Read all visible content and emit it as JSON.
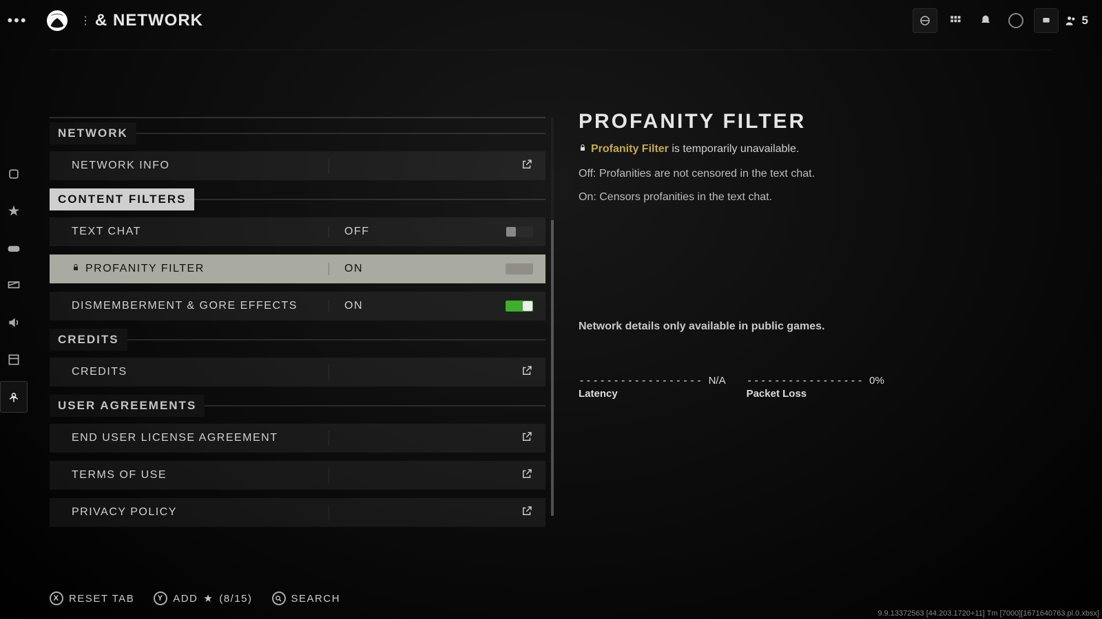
{
  "header": {
    "page_title": "& NETWORK",
    "party_count": "5"
  },
  "sections": {
    "network": {
      "label": "NETWORK"
    },
    "content_filters": {
      "label": "CONTENT FILTERS"
    },
    "credits": {
      "label": "CREDITS"
    },
    "user_agreements": {
      "label": "USER AGREEMENTS"
    }
  },
  "rows": {
    "network_info": {
      "label": "NETWORK INFO"
    },
    "text_chat": {
      "label": "TEXT CHAT",
      "value": "OFF"
    },
    "profanity_filter": {
      "label": "PROFANITY FILTER",
      "value": "ON"
    },
    "gore": {
      "label": "DISMEMBERMENT & GORE EFFECTS",
      "value": "ON"
    },
    "credits": {
      "label": "CREDITS"
    },
    "eula": {
      "label": "END USER LICENSE AGREEMENT"
    },
    "tos": {
      "label": "TERMS OF USE"
    },
    "privacy": {
      "label": "PRIVACY POLICY"
    }
  },
  "desc": {
    "title": "PROFANITY FILTER",
    "warn_highlight": "Profanity Filter",
    "warn_rest": " is temporarily unavailable.",
    "off_text": "Off: Profanities are not censored in the text chat.",
    "on_text": "On: Censors profanities in the text chat.",
    "net_note": "Network details only available in public games.",
    "latency_dashes": "------------------",
    "latency_value": "N/A",
    "latency_label": "Latency",
    "loss_dashes": "-----------------",
    "loss_value": "0%",
    "loss_label": "Packet Loss"
  },
  "footer": {
    "reset": "RESET TAB",
    "add": "ADD",
    "add_count": "(8/15)",
    "search": "SEARCH",
    "x": "X",
    "y": "Y"
  },
  "build": "9.9.13372563 [44.203.1720+11] Tm [7000][1671640763.pl.0.xbsx]"
}
